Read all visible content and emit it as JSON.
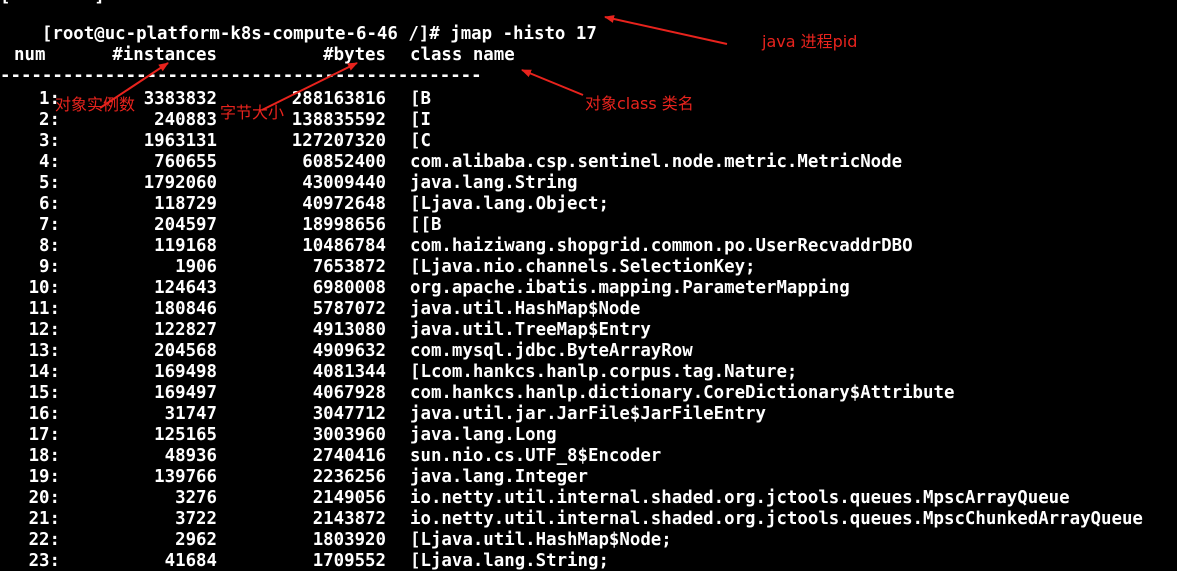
{
  "terminal": {
    "previous_line_fragment": "[        ]",
    "prompt": "[root@uc-platform-k8s-compute-6-46 /]# ",
    "command": "jmap -histo 17",
    "headers": {
      "num": "num",
      "instances": "#instances",
      "bytes": "#bytes",
      "class_name": "class name"
    },
    "separator": "----------------------------------------------",
    "rows": [
      {
        "num": "1:",
        "instances": "3383832",
        "bytes": "288163816",
        "class_name": "[B"
      },
      {
        "num": "2:",
        "instances": "240883",
        "bytes": "138835592",
        "class_name": "[I"
      },
      {
        "num": "3:",
        "instances": "1963131",
        "bytes": "127207320",
        "class_name": "[C"
      },
      {
        "num": "4:",
        "instances": "760655",
        "bytes": "60852400",
        "class_name": "com.alibaba.csp.sentinel.node.metric.MetricNode"
      },
      {
        "num": "5:",
        "instances": "1792060",
        "bytes": "43009440",
        "class_name": "java.lang.String"
      },
      {
        "num": "6:",
        "instances": "118729",
        "bytes": "40972648",
        "class_name": "[Ljava.lang.Object;"
      },
      {
        "num": "7:",
        "instances": "204597",
        "bytes": "18998656",
        "class_name": "[[B"
      },
      {
        "num": "8:",
        "instances": "119168",
        "bytes": "10486784",
        "class_name": "com.haiziwang.shopgrid.common.po.UserRecvaddrDBO"
      },
      {
        "num": "9:",
        "instances": "1906",
        "bytes": "7653872",
        "class_name": "[Ljava.nio.channels.SelectionKey;"
      },
      {
        "num": "10:",
        "instances": "124643",
        "bytes": "6980008",
        "class_name": "org.apache.ibatis.mapping.ParameterMapping"
      },
      {
        "num": "11:",
        "instances": "180846",
        "bytes": "5787072",
        "class_name": "java.util.HashMap$Node"
      },
      {
        "num": "12:",
        "instances": "122827",
        "bytes": "4913080",
        "class_name": "java.util.TreeMap$Entry"
      },
      {
        "num": "13:",
        "instances": "204568",
        "bytes": "4909632",
        "class_name": "com.mysql.jdbc.ByteArrayRow"
      },
      {
        "num": "14:",
        "instances": "169498",
        "bytes": "4081344",
        "class_name": "[Lcom.hankcs.hanlp.corpus.tag.Nature;"
      },
      {
        "num": "15:",
        "instances": "169497",
        "bytes": "4067928",
        "class_name": "com.hankcs.hanlp.dictionary.CoreDictionary$Attribute"
      },
      {
        "num": "16:",
        "instances": "31747",
        "bytes": "3047712",
        "class_name": "java.util.jar.JarFile$JarFileEntry"
      },
      {
        "num": "17:",
        "instances": "125165",
        "bytes": "3003960",
        "class_name": "java.lang.Long"
      },
      {
        "num": "18:",
        "instances": "48936",
        "bytes": "2740416",
        "class_name": "sun.nio.cs.UTF_8$Encoder"
      },
      {
        "num": "19:",
        "instances": "139766",
        "bytes": "2236256",
        "class_name": "java.lang.Integer"
      },
      {
        "num": "20:",
        "instances": "3276",
        "bytes": "2149056",
        "class_name": "io.netty.util.internal.shaded.org.jctools.queues.MpscArrayQueue"
      },
      {
        "num": "21:",
        "instances": "3722",
        "bytes": "2143872",
        "class_name": "io.netty.util.internal.shaded.org.jctools.queues.MpscChunkedArrayQueue"
      },
      {
        "num": "22:",
        "instances": "2962",
        "bytes": "1803920",
        "class_name": "[Ljava.util.HashMap$Node;"
      },
      {
        "num": "23:",
        "instances": "41684",
        "bytes": "1709552",
        "class_name": "[Ljava.lang.String;"
      }
    ]
  },
  "annotations": {
    "pid_label": "java 进程pid",
    "instances_label": "对象实例数",
    "bytes_label": "字节大小",
    "class_label": "对象class 类名"
  },
  "colors": {
    "background": "#000000",
    "text": "#ffffff",
    "annotation": "#e8231d"
  }
}
